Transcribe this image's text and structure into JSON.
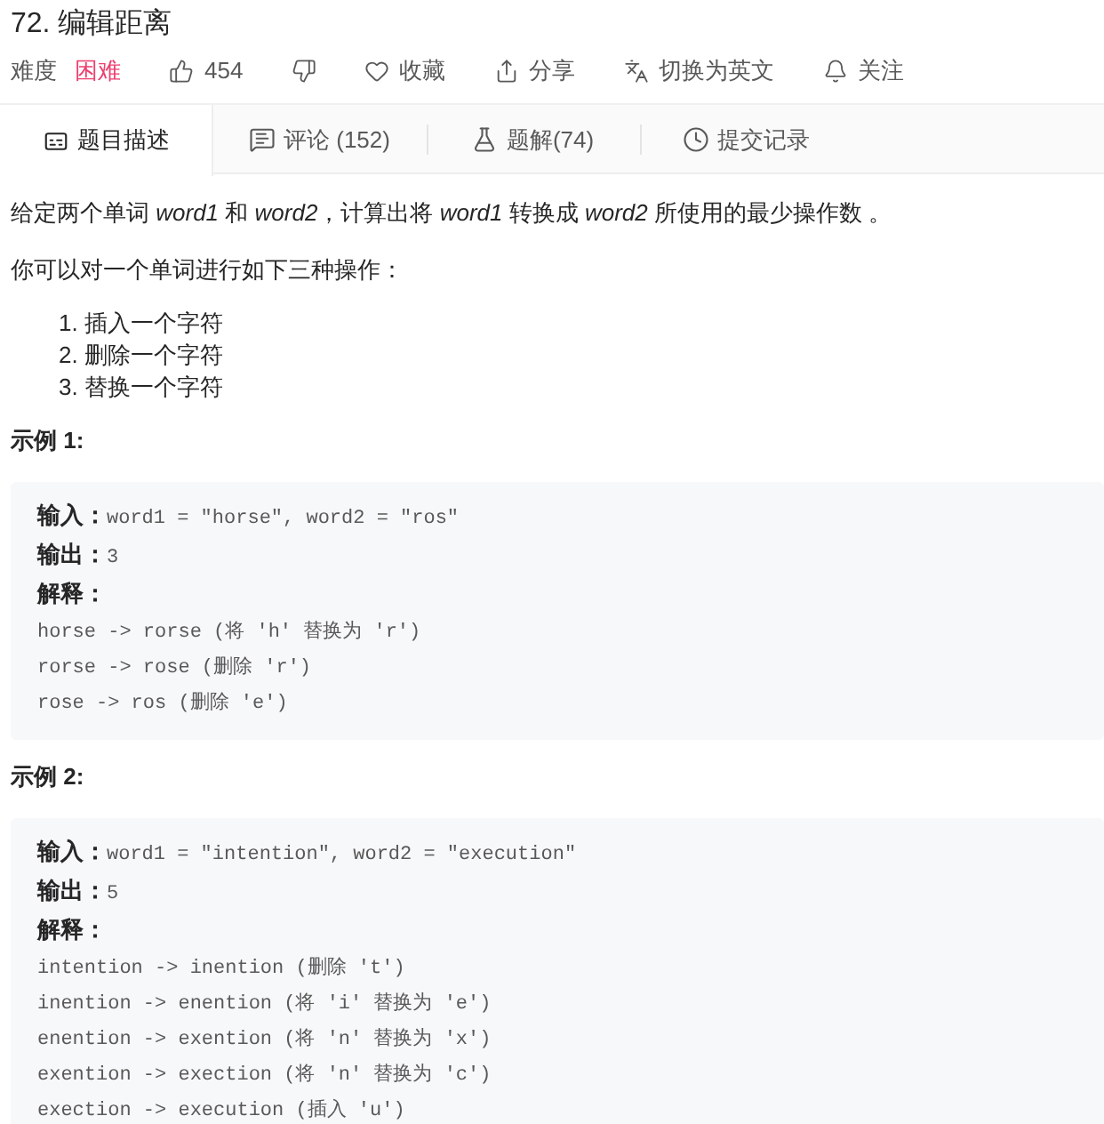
{
  "title": "72. 编辑距离",
  "meta": {
    "difficulty_label": "难度",
    "difficulty": {
      "label": "困难",
      "kind": "hard"
    },
    "actions": [
      {
        "kind": "like",
        "label": "454"
      },
      {
        "kind": "dislike"
      },
      {
        "kind": "favorite",
        "label": "收藏"
      },
      {
        "kind": "share",
        "label": "分享"
      },
      {
        "kind": "translate",
        "label": "切换为英文"
      },
      {
        "kind": "follow",
        "label": "关注"
      }
    ]
  },
  "tabs": [
    {
      "kind": "description",
      "label": "题目描述",
      "selected": true
    },
    {
      "kind": "comments",
      "label": "评论 (152)",
      "selected": false
    },
    {
      "kind": "solutions",
      "label": "题解(74)",
      "selected": false
    },
    {
      "kind": "submissions",
      "label": "提交记录",
      "selected": false
    }
  ],
  "description": {
    "intro": "给定两个单词 *word1* 和 *word2*，计算出将 *word1* 转换成 *word2* 所使用的最少操作数 。",
    "operations_lead": "你可以对一个单词进行如下三种操作：",
    "operations": [
      "1. 插入一个字符",
      "2. 删除一个字符",
      "3. 替换一个字符"
    ]
  },
  "examples": [
    {
      "heading": "示例 1:",
      "lines": [
        "**输入：**word1 = \"horse\", word2 = \"ros\"",
        "**输出：**3",
        "**解释：**",
        "horse -> rorse (将 'h' 替换为 'r')",
        "rorse -> rose (删除 'r')",
        "rose -> ros (删除 'e')"
      ]
    },
    {
      "heading": "示例 2:",
      "lines": [
        "**输入：**word1 = \"intention\", word2 = \"execution\"",
        "**输出：**5",
        "**解释：**",
        "intention -> inention (删除 't')",
        "inention -> enention (将 'i' 替换为 'e')",
        "enention -> exention (将 'n' 替换为 'x')",
        "exention -> exection (将 'n' 替换为 'c')",
        "exection -> execution (插入 'u')"
      ]
    }
  ]
}
